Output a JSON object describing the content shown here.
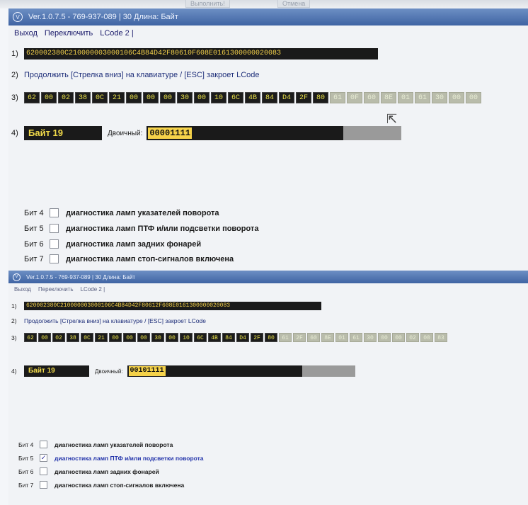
{
  "top_strip": {
    "btn_execute": "Выполнить!",
    "btn_cancel": "Отмена"
  },
  "windows": [
    {
      "title": "Ver.1.0.7.5 - 769-937-089 | 30 Длина: Байт",
      "menu": {
        "exit": "Выход",
        "switch": "Переключить",
        "lcode": "LCode 2 |"
      },
      "row1_num": "1)",
      "hex_string": "620002380C210000003000106C4B84D42F80610F608E0161300000020083",
      "row2_num": "2)",
      "instruction": "Продолжить [Стрелка вниз] на клавиатуре / [ESC] закроет LCode",
      "row3_num": "3)",
      "bytes_active": [
        "62",
        "00",
        "02",
        "38",
        "0C",
        "21",
        "00",
        "00",
        "00",
        "30",
        "00",
        "10",
        "6C",
        "4B",
        "84",
        "D4",
        "2F",
        "80"
      ],
      "bytes_dim": [
        "61",
        "0F",
        "60",
        "8E",
        "01",
        "61",
        "30",
        "00",
        "00"
      ],
      "row4_num": "4)",
      "byte_label": "Байт 19",
      "binary_label": "Двоичный:",
      "binary_value": "00001111",
      "binary_fill_fraction": 0.77,
      "bits": [
        {
          "label": "Бит 4",
          "text": "диагностика ламп указателей поворота",
          "checked": false,
          "mark": ""
        },
        {
          "label": "Бит 5",
          "text": "диагностика ламп ПТФ и/или подсветки поворота",
          "checked": false,
          "mark": ""
        },
        {
          "label": "Бит 6",
          "text": "диагностика ламп задних фонарей",
          "checked": false,
          "mark": ""
        },
        {
          "label": "Бит 7",
          "text": "диагностика ламп стоп-сигналов включена",
          "checked": false,
          "mark": ""
        }
      ]
    },
    {
      "title": "Ver.1.0.7.5 - 769-937-089 | 30 Длина: Байт",
      "menu": {
        "exit": "Выход",
        "switch": "Переключить",
        "lcode": "LCode 2 |"
      },
      "row1_num": "1)",
      "hex_string": "620002380C210000003000106C4B84D42F80612F608E0161300000020083",
      "row2_num": "2)",
      "instruction": "Продолжить [Стрелка вниз] на клавиатуре / [ESC] закроет LCode",
      "row3_num": "3)",
      "bytes_active": [
        "62",
        "00",
        "02",
        "38",
        "0C",
        "21",
        "00",
        "00",
        "00",
        "30",
        "00",
        "10",
        "6C",
        "4B",
        "84",
        "D4",
        "2F",
        "80"
      ],
      "bytes_dim": [
        "61",
        "2F",
        "60",
        "8E",
        "01",
        "61",
        "30",
        "00",
        "00",
        "02",
        "00",
        "83"
      ],
      "row4_num": "4)",
      "byte_label": "Байт 19",
      "binary_label": "Двоичный:",
      "binary_value": "00101111",
      "binary_fill_fraction": 0.77,
      "bits": [
        {
          "label": "Бит 4",
          "text": "диагностика ламп указателей поворота",
          "checked": false,
          "mark": ""
        },
        {
          "label": "Бит 5",
          "text": "диагностика ламп ПТФ и/или подсветки поворота",
          "checked": true,
          "mark": "✓"
        },
        {
          "label": "Бит 6",
          "text": "диагностика ламп задних фонарей",
          "checked": false,
          "mark": ""
        },
        {
          "label": "Бит 7",
          "text": "диагностика ламп стоп-сигналов включена",
          "checked": false,
          "mark": ""
        }
      ]
    }
  ]
}
